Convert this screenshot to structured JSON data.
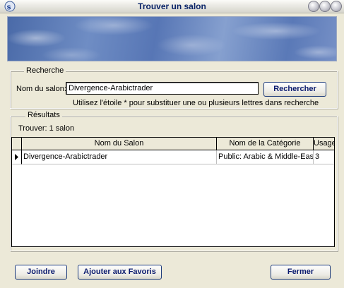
{
  "window": {
    "title": "Trouver un salon"
  },
  "search": {
    "group_label": "Recherche",
    "field_label": "Nom du salon:",
    "field_value": "Divergence-Arabictrader",
    "button_label": "Rechercher",
    "hint": "Utilisez l'étoile * pour substituer une ou plusieurs lettres dans recherche"
  },
  "results": {
    "group_label": "Résultats",
    "count_text": "Trouver: 1 salon",
    "columns": [
      "Nom du Salon",
      "Nom de la Catégorie",
      "Usagers"
    ],
    "rows": [
      {
        "name": "Divergence-Arabictrader",
        "category": "Public: Arabic & Middle-East",
        "users": "3"
      }
    ]
  },
  "footer": {
    "join_label": "Joindre",
    "favorites_label": "Ajouter aux Favoris",
    "close_label": "Fermer"
  }
}
